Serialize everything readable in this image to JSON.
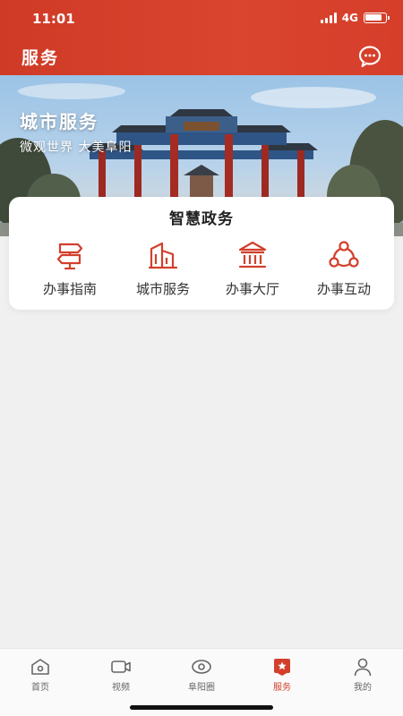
{
  "status_bar": {
    "time": "11:01",
    "network": "4G",
    "battery_level": 0.85
  },
  "header": {
    "title": "服务",
    "message_icon": "chat-bubble-icon"
  },
  "banner": {
    "title": "城市服务",
    "subtitle": "微观世界  大美阜阳"
  },
  "card": {
    "title": "智慧政务",
    "items": [
      {
        "label": "办事指南",
        "icon": "signpost-icon"
      },
      {
        "label": "城市服务",
        "icon": "city-building-icon"
      },
      {
        "label": "办事大厅",
        "icon": "government-hall-icon"
      },
      {
        "label": "办事互动",
        "icon": "interaction-network-icon"
      }
    ]
  },
  "tabs": [
    {
      "label": "首页",
      "icon": "home-icon",
      "active": false
    },
    {
      "label": "视频",
      "icon": "video-camera-icon",
      "active": false
    },
    {
      "label": "阜阳圈",
      "icon": "eye-icon",
      "active": false
    },
    {
      "label": "服务",
      "icon": "star-bookmark-icon",
      "active": true
    },
    {
      "label": "我的",
      "icon": "person-icon",
      "active": false
    }
  ],
  "colors": {
    "brand": "#d2402c",
    "icon_stroke": "#d2402c",
    "tab_inactive": "#666666"
  }
}
